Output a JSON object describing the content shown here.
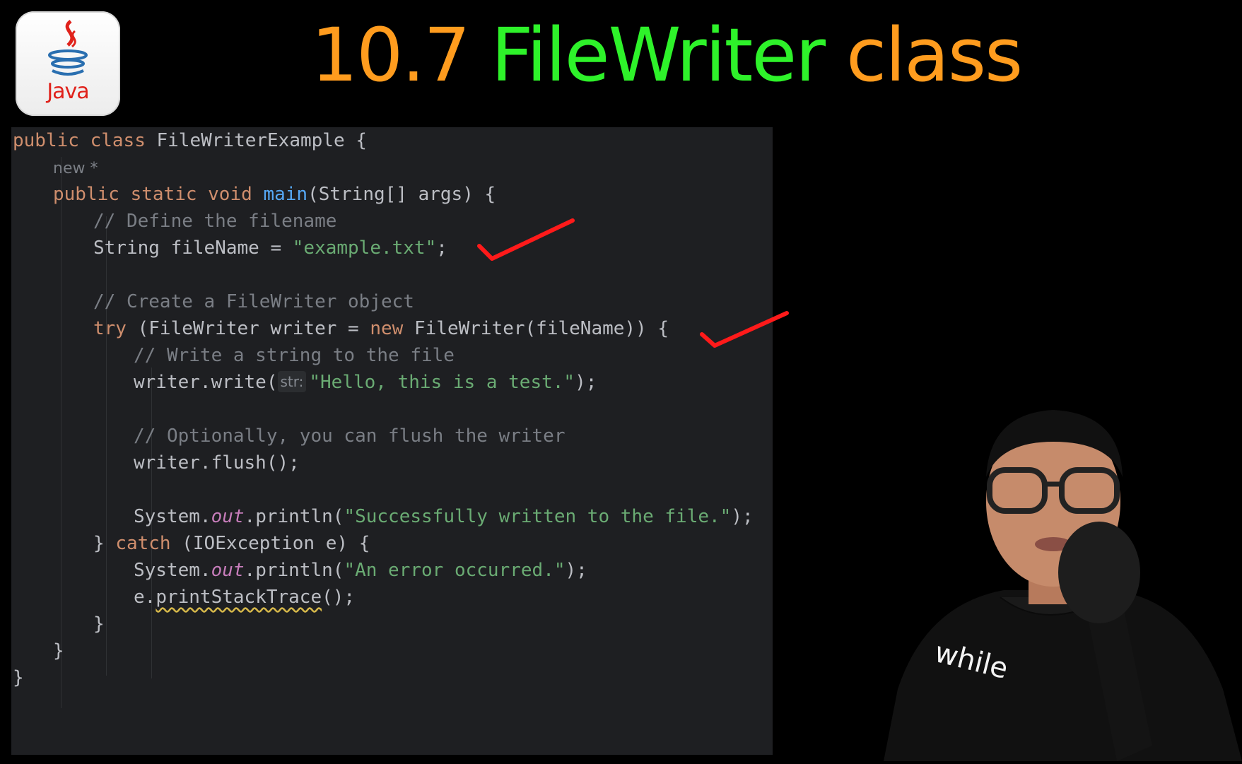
{
  "logo": {
    "label": "Java",
    "icon": "java-coffee-cup-icon"
  },
  "title": {
    "number": "10.7",
    "main": "FileWriter",
    "suffix": "class"
  },
  "editor": {
    "lines": [
      {
        "indent": 0,
        "tokens": [
          [
            "kw",
            "public "
          ],
          [
            "kw",
            "class "
          ],
          [
            "",
            "FileWriterExample {"
          ]
        ]
      },
      {
        "indent": 1,
        "tokens": [
          [
            "muted",
            "new *"
          ]
        ]
      },
      {
        "indent": 1,
        "tokens": [
          [
            "kw",
            "public "
          ],
          [
            "kw",
            "static "
          ],
          [
            "kw",
            "void "
          ],
          [
            "fn",
            "main"
          ],
          [
            "",
            "(String[] args) {"
          ]
        ]
      },
      {
        "indent": 2,
        "tokens": [
          [
            "cm",
            "// Define the filename"
          ]
        ]
      },
      {
        "indent": 2,
        "tokens": [
          [
            "",
            "String fileName = "
          ],
          [
            "str",
            "\"example.txt\""
          ],
          [
            "",
            ";"
          ]
        ]
      },
      {
        "indent": 2,
        "tokens": []
      },
      {
        "indent": 2,
        "tokens": [
          [
            "cm",
            "// Create a FileWriter object"
          ]
        ]
      },
      {
        "indent": 2,
        "tokens": [
          [
            "kw",
            "try "
          ],
          [
            "",
            "(FileWriter writer = "
          ],
          [
            "kw",
            "new "
          ],
          [
            "",
            "FileWriter(fileName)) {"
          ]
        ]
      },
      {
        "indent": 3,
        "tokens": [
          [
            "cm",
            "// Write a string to the file"
          ]
        ]
      },
      {
        "indent": 3,
        "tokens": [
          [
            "",
            "writer.write("
          ],
          [
            "hint",
            "str:"
          ],
          [
            "str",
            "\"Hello, this is a test.\""
          ],
          [
            "",
            ");"
          ]
        ]
      },
      {
        "indent": 3,
        "tokens": []
      },
      {
        "indent": 3,
        "tokens": [
          [
            "cm",
            "// Optionally, you can flush the writer"
          ]
        ]
      },
      {
        "indent": 3,
        "tokens": [
          [
            "",
            "writer.flush();"
          ]
        ]
      },
      {
        "indent": 3,
        "tokens": []
      },
      {
        "indent": 3,
        "tokens": [
          [
            "",
            "System."
          ],
          [
            "it",
            "out"
          ],
          [
            "",
            ".println("
          ],
          [
            "str",
            "\"Successfully written to the file.\""
          ],
          [
            "",
            ");"
          ]
        ]
      },
      {
        "indent": 2,
        "tokens": [
          [
            "",
            "} "
          ],
          [
            "kw",
            "catch "
          ],
          [
            "",
            "(IOException e) {"
          ]
        ]
      },
      {
        "indent": 3,
        "tokens": [
          [
            "",
            "System."
          ],
          [
            "it",
            "out"
          ],
          [
            "",
            ".println("
          ],
          [
            "str",
            "\"An error occurred.\""
          ],
          [
            "",
            ");"
          ]
        ]
      },
      {
        "indent": 3,
        "tokens": [
          [
            "",
            "e."
          ],
          [
            "squiggle",
            "printStackTrace"
          ],
          [
            "",
            "();"
          ]
        ]
      },
      {
        "indent": 2,
        "tokens": [
          [
            "",
            "}"
          ]
        ]
      },
      {
        "indent": 1,
        "tokens": [
          [
            "",
            "}"
          ]
        ]
      },
      {
        "indent": 0,
        "tokens": [
          [
            "",
            "}"
          ]
        ]
      }
    ]
  },
  "annotations": [
    {
      "name": "checkmark-1",
      "color": "#ff1a1a",
      "near_line": 4
    },
    {
      "name": "checkmark-2",
      "color": "#ff1a1a",
      "near_line": 7
    }
  ],
  "presenter": {
    "shirt_text": "while"
  }
}
